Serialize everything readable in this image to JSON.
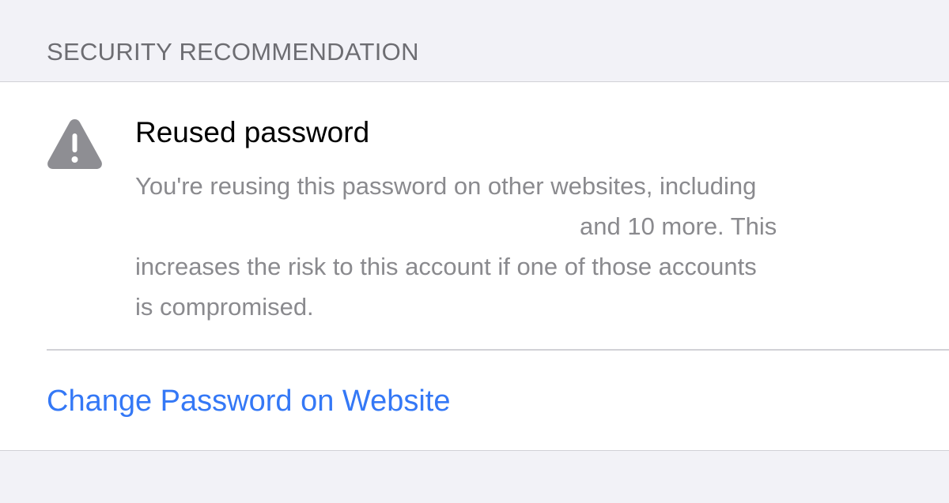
{
  "section": {
    "header": "SECURITY RECOMMENDATION"
  },
  "recommendation": {
    "icon": "warning-triangle-icon",
    "title": "Reused password",
    "description_line1": "You're reusing this password on other websites, including",
    "description_line2": "and 10 more. This",
    "description_line3": "increases the risk to this account if one of those accounts",
    "description_line4": "is compromised."
  },
  "action": {
    "label": "Change Password on Website"
  },
  "colors": {
    "background": "#f2f2f7",
    "card": "#ffffff",
    "link": "#3478f6",
    "icon": "#8e8e93",
    "secondary_text": "#8a8a8e",
    "header_text": "#6d6d72"
  }
}
